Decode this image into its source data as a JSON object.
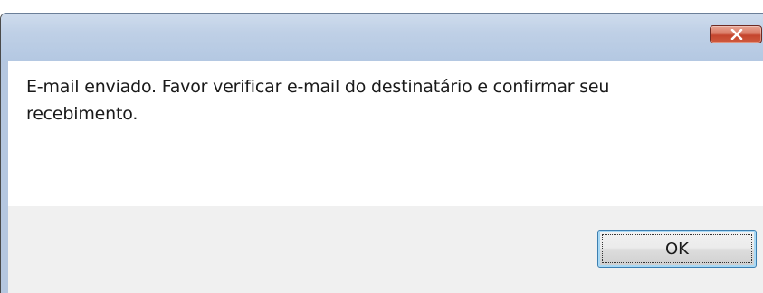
{
  "dialog": {
    "title": "",
    "message": "E-mail enviado. Favor verificar e-mail do destinatário e confirmar seu recebimento.",
    "ok_label": "OK"
  },
  "icons": {
    "close": "close-icon"
  },
  "colors": {
    "titlebar": "#bfd0e6",
    "close_button": "#c4452d",
    "content_background": "#ffffff",
    "button_area_background": "#f0f0f0",
    "ok_button_border": "#3c7fb1"
  }
}
